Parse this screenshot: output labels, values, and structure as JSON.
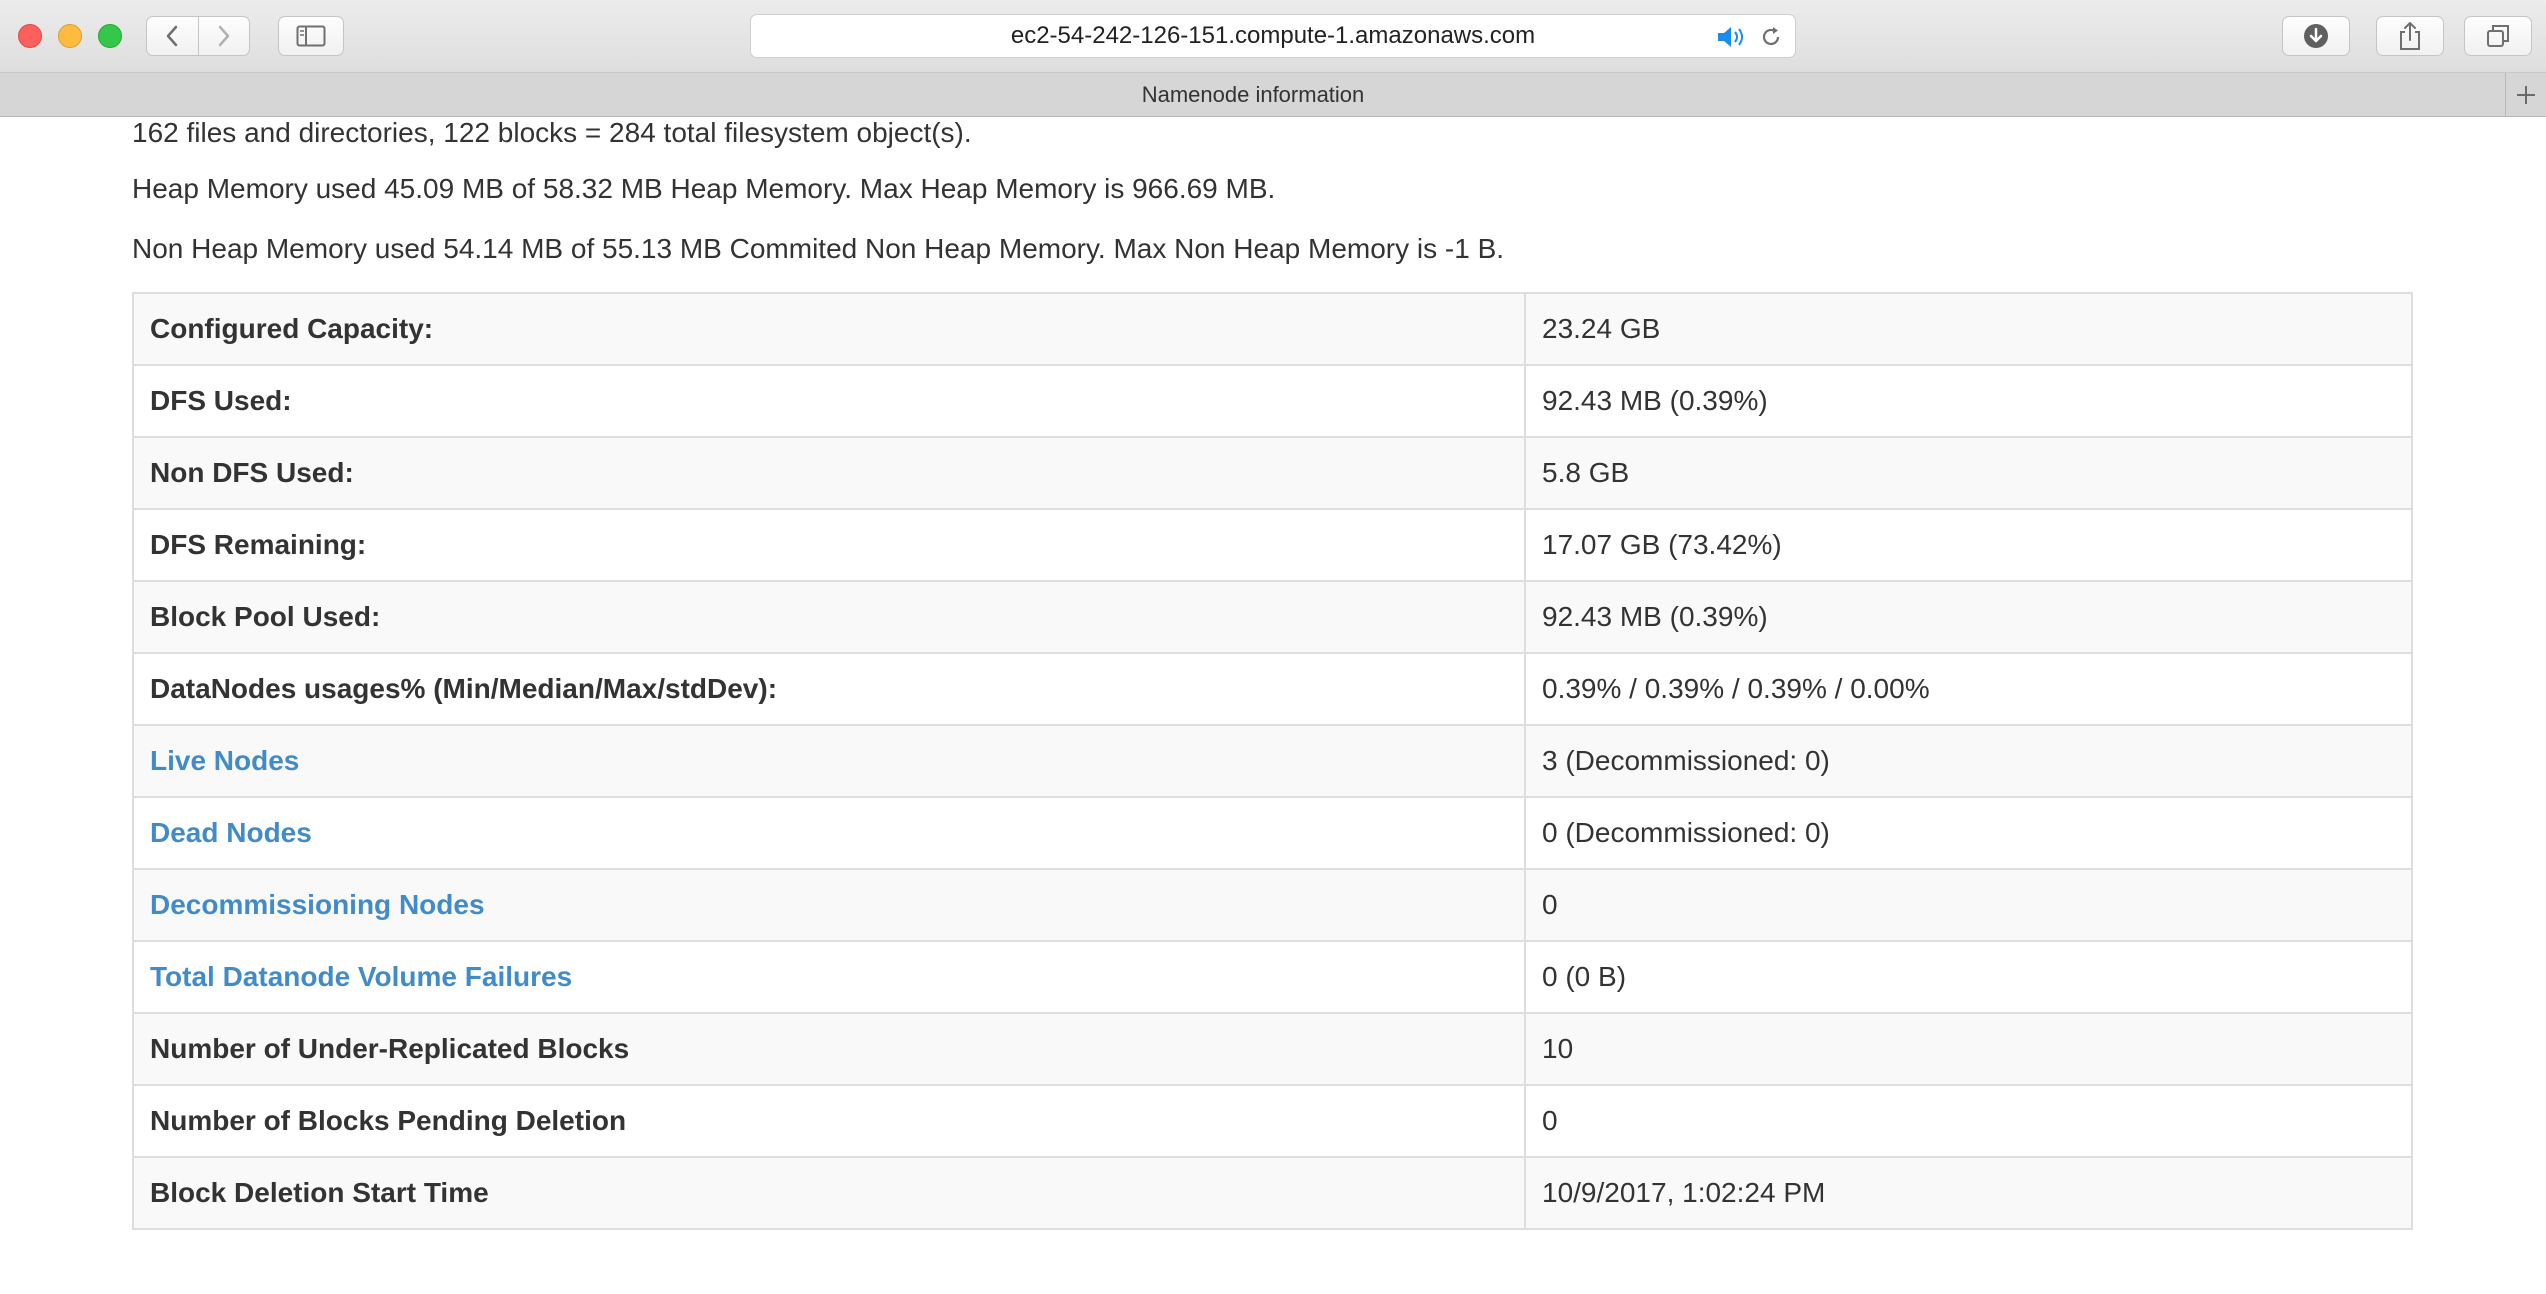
{
  "browser": {
    "url": "ec2-54-242-126-151.compute-1.amazonaws.com",
    "tab_title": "Namenode information"
  },
  "summary": {
    "files_line": "162 files and directories, 122 blocks = 284 total filesystem object(s).",
    "heap_line": "Heap Memory used 45.09 MB of 58.32 MB Heap Memory. Max Heap Memory is 966.69 MB.",
    "nonheap_line": "Non Heap Memory used 54.14 MB of 55.13 MB Commited Non Heap Memory. Max Non Heap Memory is -1 B."
  },
  "table": {
    "rows": [
      {
        "label": "Configured Capacity:",
        "value": "23.24 GB"
      },
      {
        "label": "DFS Used:",
        "value": "92.43 MB (0.39%)"
      },
      {
        "label": "Non DFS Used:",
        "value": "5.8 GB"
      },
      {
        "label": "DFS Remaining:",
        "value": "17.07 GB (73.42%)"
      },
      {
        "label": "Block Pool Used:",
        "value": "92.43 MB (0.39%)"
      },
      {
        "label": "DataNodes usages% (Min/Median/Max/stdDev):",
        "value": "0.39% / 0.39% / 0.39% / 0.00%"
      },
      {
        "label": "Live Nodes",
        "value": "3 (Decommissioned: 0)"
      },
      {
        "label": "Dead Nodes",
        "value": "0 (Decommissioned: 0)"
      },
      {
        "label": "Decommissioning Nodes",
        "value": "0"
      },
      {
        "label": "Total Datanode Volume Failures",
        "value": "0 (0 B)"
      },
      {
        "label": "Number of Under-Replicated Blocks",
        "value": "10"
      },
      {
        "label": "Number of Blocks Pending Deletion",
        "value": "0"
      },
      {
        "label": "Block Deletion Start Time",
        "value": "10/9/2017, 1:02:24 PM"
      }
    ]
  },
  "colors": {
    "link": "#428bca",
    "text": "#333333",
    "table_border": "#dddddd",
    "stripe": "#f9f9f9"
  },
  "icons": {
    "back": "chevron-left-icon",
    "forward": "chevron-right-icon",
    "sidebar": "sidebar-icon",
    "audio": "speaker-icon",
    "reload": "reload-icon",
    "downloads": "download-icon",
    "share": "share-icon",
    "tabs": "tabs-overview-icon",
    "new_tab": "plus-icon"
  }
}
